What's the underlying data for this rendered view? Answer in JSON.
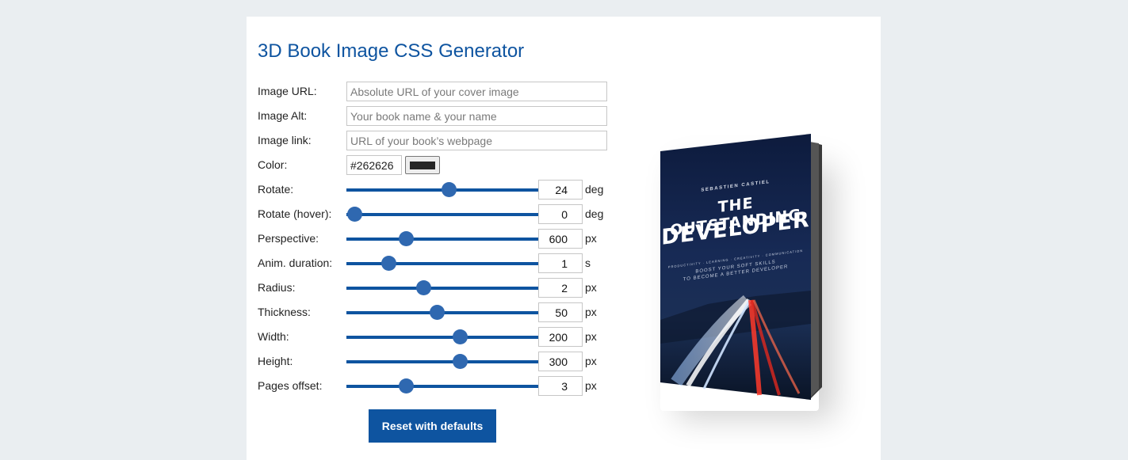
{
  "page": {
    "title": "3D Book Image CSS Generator"
  },
  "form": {
    "image_url": {
      "label": "Image URL:",
      "placeholder": "Absolute URL of your cover image",
      "value": ""
    },
    "image_alt": {
      "label": "Image Alt:",
      "placeholder": "Your book name & your name",
      "value": ""
    },
    "image_link": {
      "label": "Image link:",
      "placeholder": "URL of your book’s webpage",
      "value": ""
    },
    "color": {
      "label": "Color:",
      "value": "#262626",
      "swatch": "#262626"
    },
    "sliders": [
      {
        "key": "rotate",
        "label": "Rotate:",
        "value": "24",
        "unit": "deg",
        "fraction": 0.53
      },
      {
        "key": "rotate-hover",
        "label": "Rotate (hover):",
        "value": "0",
        "unit": "deg",
        "fraction": 0.04
      },
      {
        "key": "perspective",
        "label": "Perspective:",
        "value": "600",
        "unit": "px",
        "fraction": 0.31
      },
      {
        "key": "anim-duration",
        "label": "Anim. duration:",
        "value": "1",
        "unit": "s",
        "fraction": 0.22
      },
      {
        "key": "radius",
        "label": "Radius:",
        "value": "2",
        "unit": "px",
        "fraction": 0.4
      },
      {
        "key": "thickness",
        "label": "Thickness:",
        "value": "50",
        "unit": "px",
        "fraction": 0.47
      },
      {
        "key": "width",
        "label": "Width:",
        "value": "200",
        "unit": "px",
        "fraction": 0.59
      },
      {
        "key": "height",
        "label": "Height:",
        "value": "300",
        "unit": "px",
        "fraction": 0.59
      },
      {
        "key": "pages-offset",
        "label": "Pages offset:",
        "value": "3",
        "unit": "px",
        "fraction": 0.31
      }
    ],
    "reset_label": "Reset with defaults"
  },
  "book": {
    "author": "SEBASTIEN CASTIEL",
    "title_line1": "THE OUTSTANDING",
    "title_line2": "DEVELOPER",
    "tagline": "PRODUCTIVITY · LEARNING · CREATIVITY · COMMUNICATION",
    "subtitle_line1": "BOOST YOUR SOFT SKILLS",
    "subtitle_line2": "TO BECOME A BETTER DEVELOPER"
  },
  "colors": {
    "accent": "#0e54a0",
    "thumb": "#2f68b0",
    "background": "#eaeef1"
  }
}
